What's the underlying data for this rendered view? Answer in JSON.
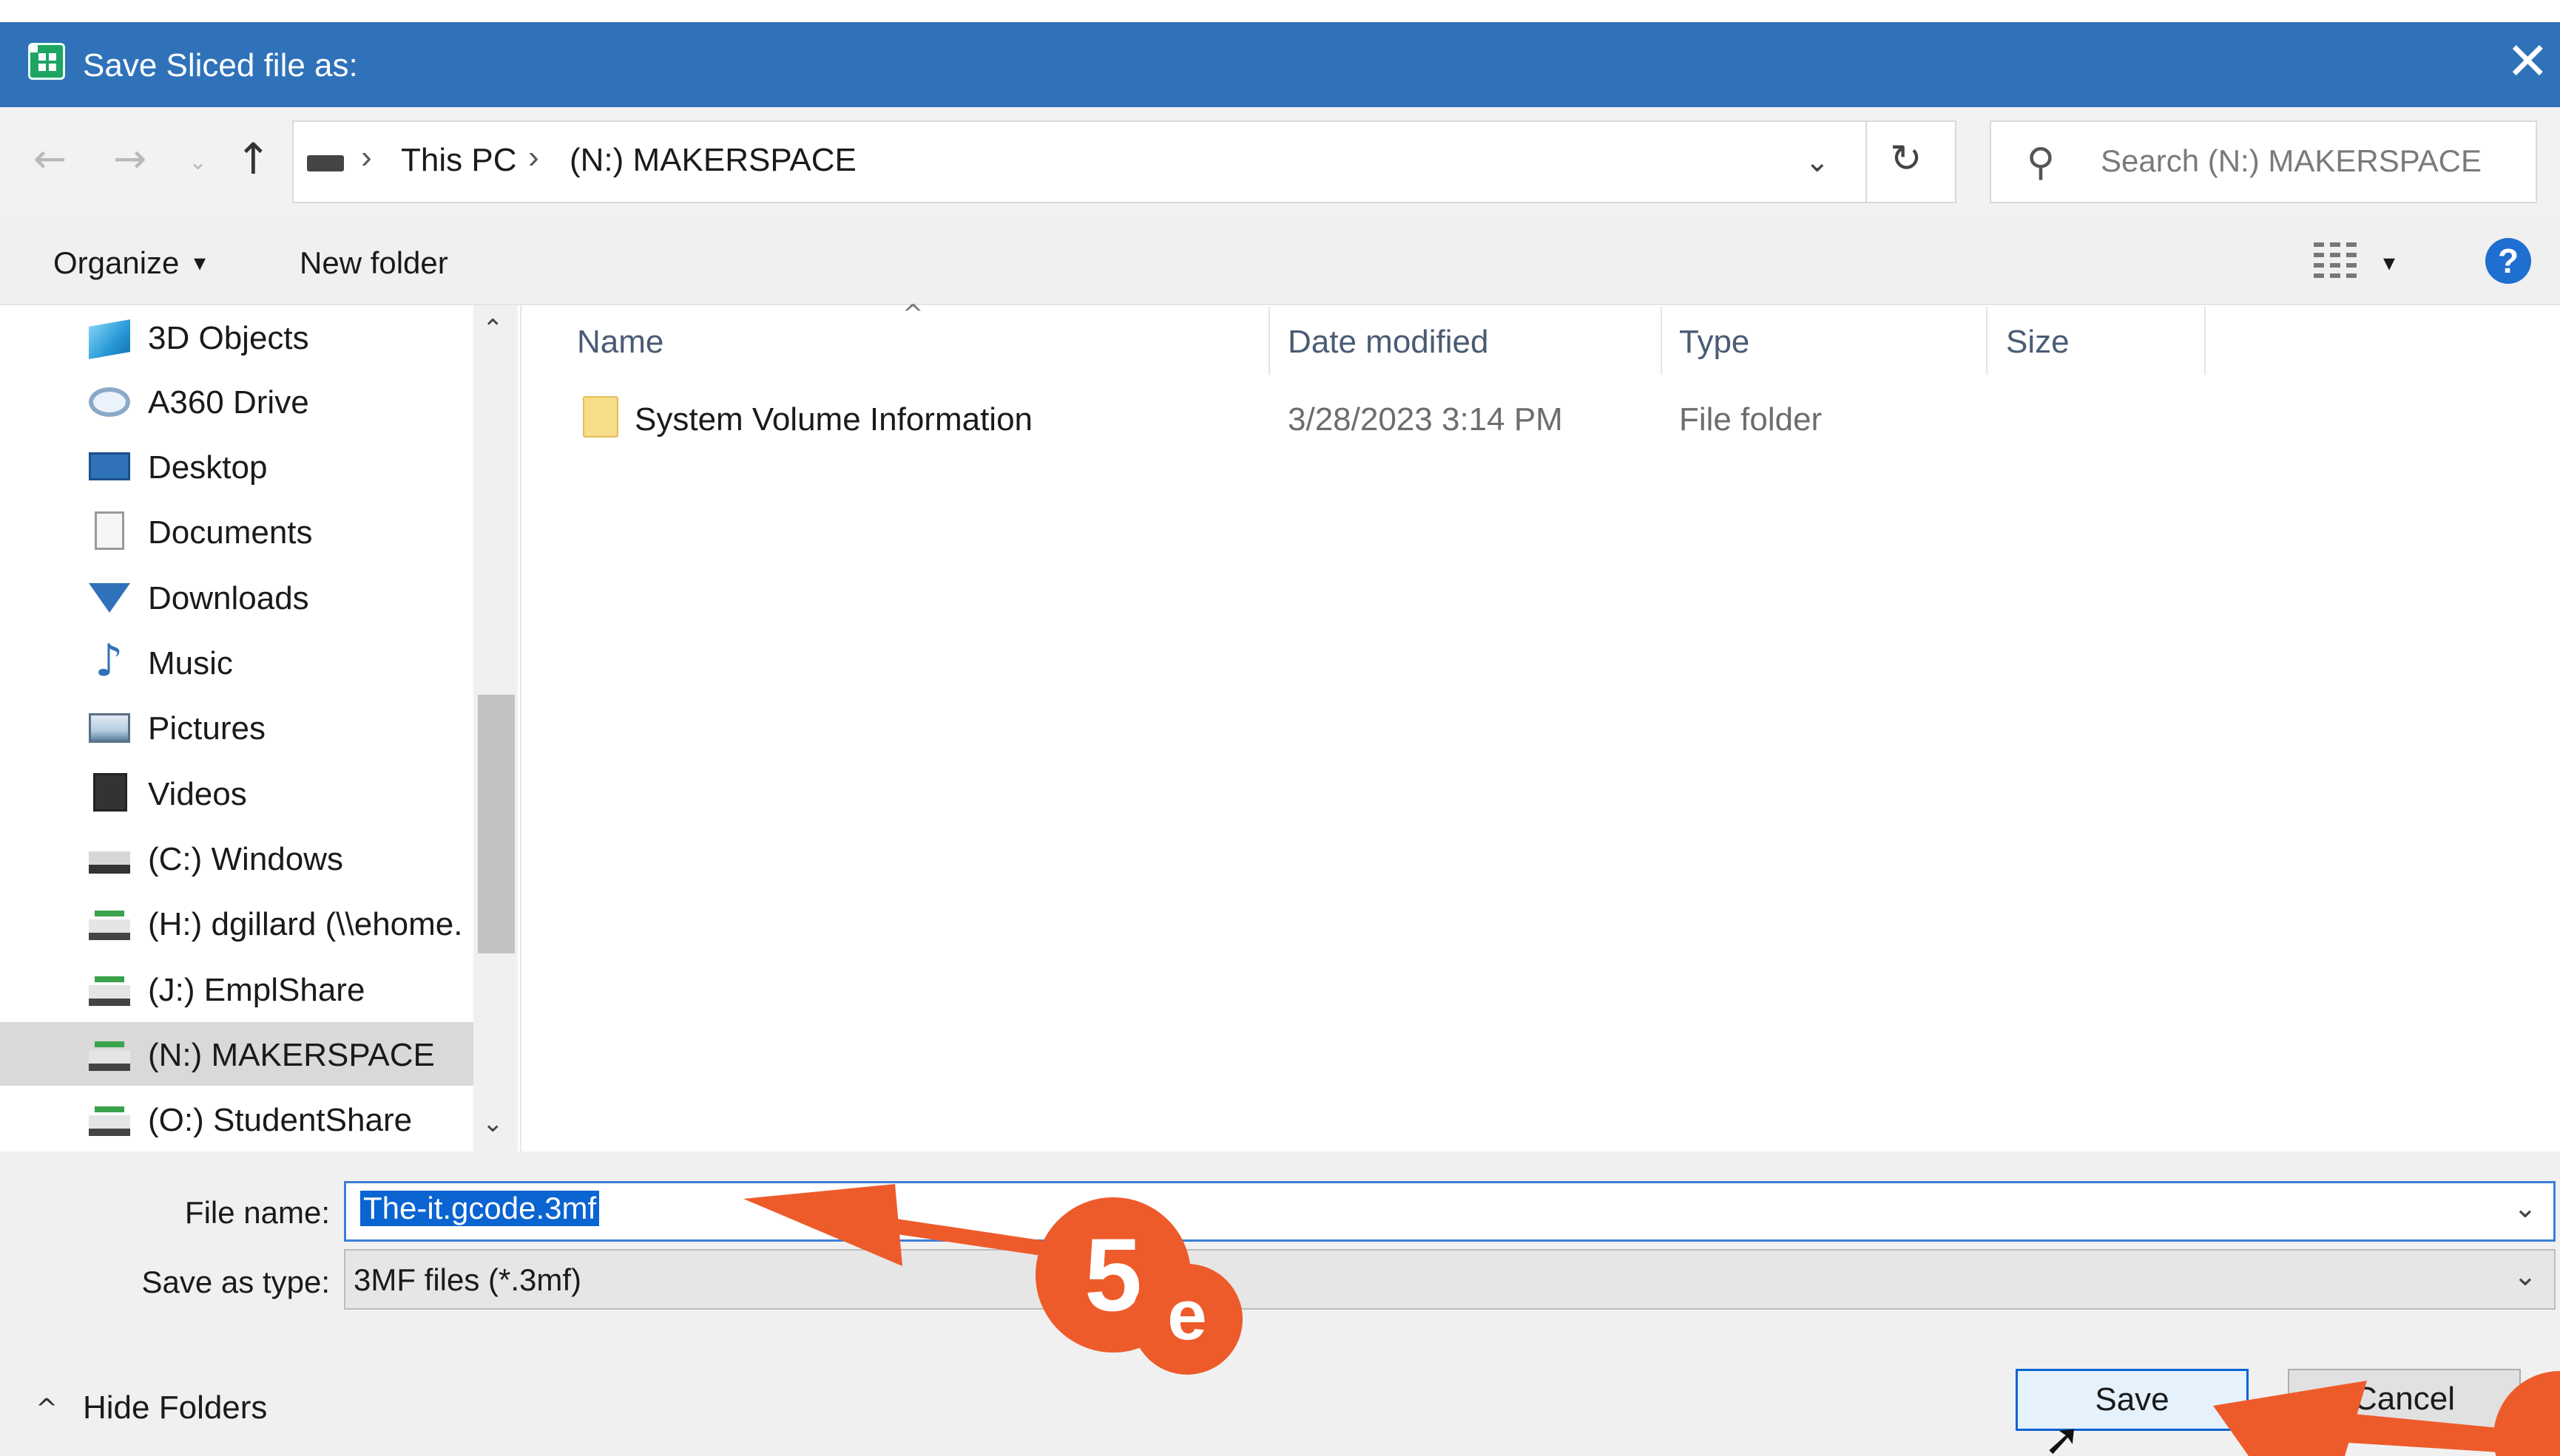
{
  "window": {
    "title": "Save Sliced file as:",
    "close_glyph": "✕",
    "app_icon": "slicer-app-icon"
  },
  "nav": {
    "back_glyph": "←",
    "forward_glyph": "→",
    "recent_glyph": "⌄",
    "up_glyph": "↑",
    "breadcrumb": [
      "This PC",
      "(N:) MAKERSPACE"
    ],
    "separator": "›",
    "dropdown_glyph": "⌄",
    "refresh_glyph": "↻",
    "search_placeholder": "Search (N:) MAKERSPACE",
    "search_glyph": "⚲"
  },
  "commandbar": {
    "organize_label": "Organize",
    "organize_caret": "▾",
    "new_folder_label": "New folder",
    "view_caret": "▾",
    "help_label": "?"
  },
  "navpane": {
    "scroll_up": "⌃",
    "scroll_down": "⌄",
    "items": [
      {
        "label": "3D Objects",
        "icon": "3d-objects-icon"
      },
      {
        "label": "A360 Drive",
        "icon": "a360-drive-icon"
      },
      {
        "label": "Desktop",
        "icon": "desktop-icon"
      },
      {
        "label": "Documents",
        "icon": "documents-icon"
      },
      {
        "label": "Downloads",
        "icon": "downloads-icon"
      },
      {
        "label": "Music",
        "icon": "music-icon"
      },
      {
        "label": "Pictures",
        "icon": "pictures-icon"
      },
      {
        "label": "Videos",
        "icon": "videos-icon"
      },
      {
        "label": "(C:) Windows",
        "icon": "windows-drive-icon"
      },
      {
        "label": "(H:) dgillard (\\\\ehome.",
        "icon": "network-drive-icon"
      },
      {
        "label": "(J:) EmplShare",
        "icon": "network-drive-icon"
      },
      {
        "label": "(N:) MAKERSPACE",
        "icon": "network-drive-icon",
        "selected": true
      },
      {
        "label": "(O:) StudentShare",
        "icon": "network-drive-icon"
      }
    ]
  },
  "filelist": {
    "sort_caret": "^",
    "columns": [
      "Name",
      "Date modified",
      "Type",
      "Size"
    ],
    "rows": [
      {
        "name": "System Volume Information",
        "date": "3/28/2023 3:14 PM",
        "type": "File folder",
        "size": ""
      }
    ]
  },
  "bottom": {
    "file_name_label": "File name:",
    "file_name_value": "The-it.gcode.3mf",
    "save_as_type_label": "Save as type:",
    "save_as_type_value": "3MF files (*.3mf)",
    "caret": "⌄",
    "hide_folders_caret": "^",
    "hide_folders_label": "Hide Folders",
    "save_label": "Save",
    "cancel_label": "Cancel"
  },
  "callout": {
    "step_number": "5",
    "step_letter": "e",
    "color": "#ee5b2b"
  },
  "colors": {
    "titlebar": "#2f72b9",
    "selection": "#0a64d1"
  }
}
